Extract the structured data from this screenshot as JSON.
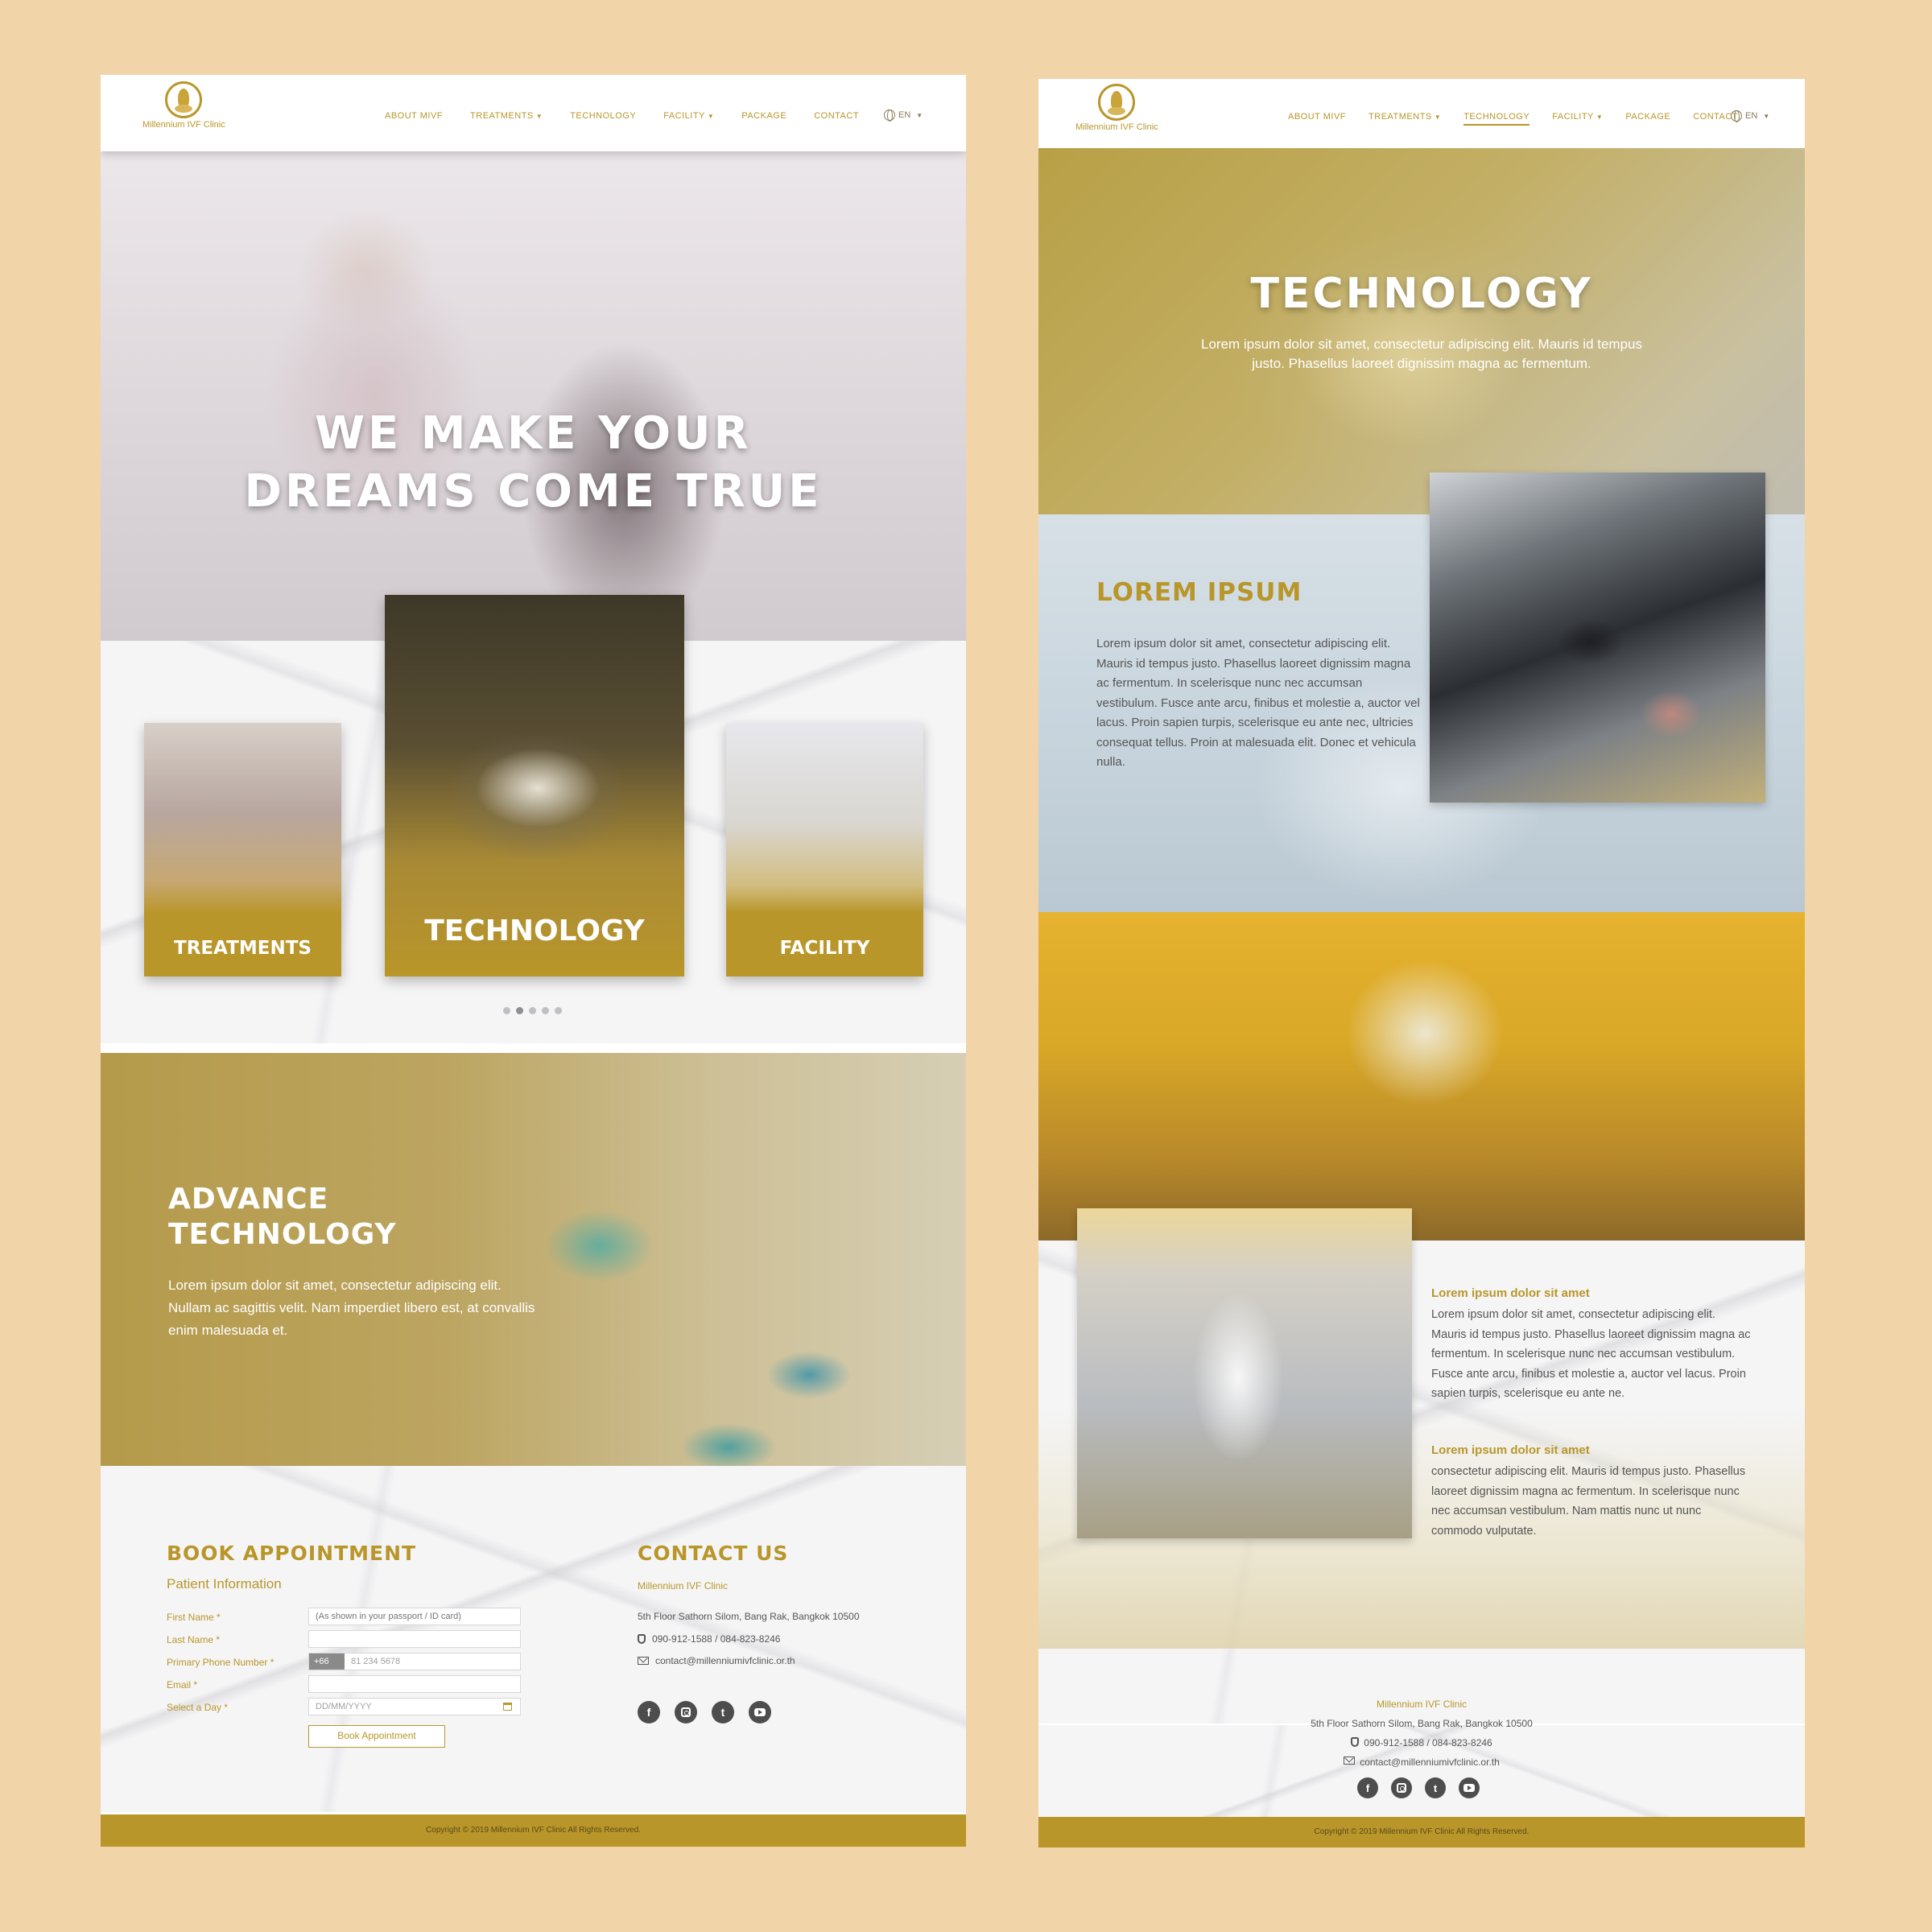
{
  "brand": {
    "name": "Millennium IVF Clinic",
    "accent": "#b9962a",
    "background": "#f2d4a9"
  },
  "nav": {
    "items": [
      "ABOUT MIVF",
      "TREATMENTS",
      "TECHNOLOGY",
      "FACILITY",
      "PACKAGE",
      "CONTACT"
    ],
    "lang": "EN"
  },
  "home": {
    "hero_title_line1": "WE MAKE YOUR",
    "hero_title_line2": "DREAMS COME TRUE",
    "cards": [
      "TREATMENTS",
      "TECHNOLOGY",
      "FACILITY"
    ],
    "advance": {
      "title_line1": "ADVANCE",
      "title_line2": "TECHNOLOGY",
      "body": "Lorem ipsum dolor sit amet, consectetur adipiscing elit. Nullam ac sagittis velit. Nam imperdiet libero est, at convallis enim malesuada et."
    },
    "booking": {
      "title": "BOOK APPOINTMENT",
      "subtitle": "Patient Information",
      "first_name_label": "First Name *",
      "first_name_placeholder": "(As shown in your passport / ID card)",
      "last_name_label": "Last Name *",
      "phone_label": "Primary Phone Number *",
      "phone_prefix": "+66",
      "phone_placeholder": "81 234 5678",
      "email_label": "Email *",
      "day_label": "Select a Day *",
      "day_placeholder": "DD/MM/YYYY",
      "button": "Book Appointment"
    },
    "contact": {
      "title": "CONTACT US"
    }
  },
  "contact_info": {
    "name": "Millennium IVF Clinic",
    "address": "5th Floor Sathorn Silom, Bang Rak, Bangkok 10500",
    "phone": "090-912-1588 / 084-823-8246",
    "email": "contact@millenniumivfclinic.or.th"
  },
  "socials": [
    "facebook-icon",
    "instagram-icon",
    "twitter-icon",
    "youtube-icon"
  ],
  "copyright": "Copyright © 2019 Millennium IVF Clinic All Rights Reserved.",
  "technology_page": {
    "hero_title": "TECHNOLOGY",
    "hero_body": "Lorem ipsum dolor sit amet, consectetur adipiscing elit. Mauris id tempus justo. Phasellus laoreet dignissim magna ac fermentum.",
    "section_title": "LOREM IPSUM",
    "section_body": "Lorem ipsum dolor sit amet, consectetur adipiscing elit. Mauris id tempus justo. Phasellus laoreet dignissim magna ac fermentum. In scelerisque nunc nec accumsan vestibulum. Fusce ante arcu, finibus et molestie a, auctor vel lacus. Proin sapien turpis, scelerisque eu ante nec, ultricies consequat tellus. Proin at malesuada elit. Donec et vehicula nulla.",
    "block1_title": "Lorem ipsum dolor sit amet",
    "block1_body": "Lorem ipsum dolor sit amet, consectetur adipiscing elit. Mauris id tempus justo. Phasellus laoreet dignissim magna ac fermentum. In scelerisque nunc nec accumsan vestibulum. Fusce ante arcu, finibus et molestie a, auctor vel lacus. Proin sapien turpis, scelerisque eu ante ne.",
    "block2_title": "Lorem ipsum dolor sit amet",
    "block2_body": "consectetur adipiscing elit. Mauris id tempus justo. Phasellus laoreet dignissim magna ac fermentum. In scelerisque nunc nec accumsan vestibulum. Nam mattis nunc ut nunc commodo vulputate."
  }
}
